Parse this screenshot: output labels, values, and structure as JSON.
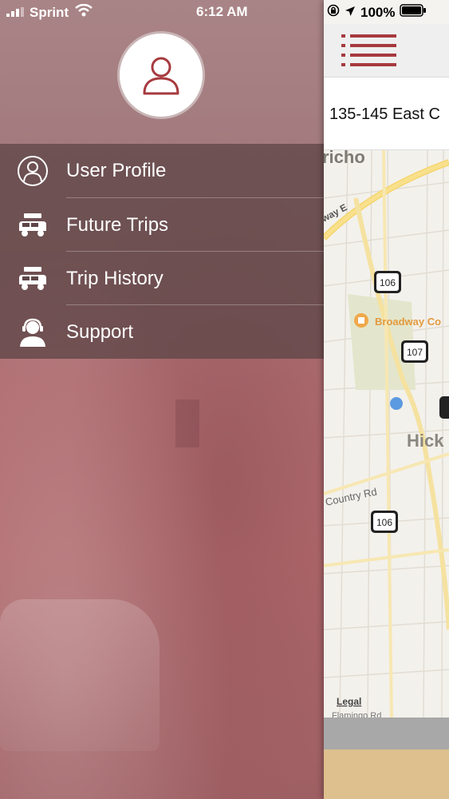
{
  "status_bar": {
    "carrier": "Sprint",
    "time": "6:12 AM",
    "battery": "100%"
  },
  "drawer": {
    "menu": [
      {
        "label": "User Profile",
        "icon": "user-circle-icon"
      },
      {
        "label": "Future Trips",
        "icon": "car-luggage-icon"
      },
      {
        "label": "Trip History",
        "icon": "car-luggage-icon"
      },
      {
        "label": "Support",
        "icon": "headset-agent-icon"
      }
    ]
  },
  "map_panel": {
    "address": "135-145 East C",
    "map_labels": {
      "town_top": "richo",
      "road_1": "way E",
      "route_106_a": "106",
      "route_107": "107",
      "route_106_b": "106",
      "poi": "Broadway Co",
      "town": "Hick",
      "road_country": "Country Rd",
      "legal": "Legal",
      "road_bottom": "Flamingo Rd"
    }
  },
  "colors": {
    "accent": "#a63a3e",
    "drawer_tint": "#b06d71",
    "menu_overlay": "#5f4648"
  }
}
